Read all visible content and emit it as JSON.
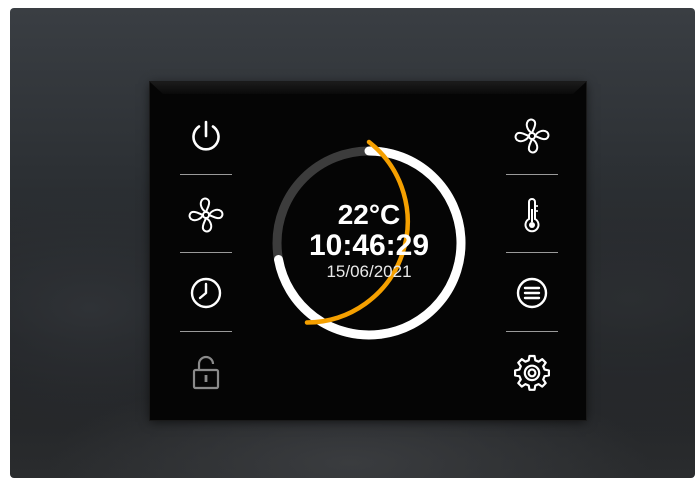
{
  "thermostat": {
    "temperature": "22°C",
    "time": "10:46:29",
    "date": "15/06/2021",
    "setpoint_fraction": 0.5
  },
  "left_buttons": [
    {
      "icon": "power-icon"
    },
    {
      "icon": "fan-icon"
    },
    {
      "icon": "clock-icon"
    },
    {
      "icon": "lock-icon"
    }
  ],
  "right_buttons": [
    {
      "icon": "fan-icon"
    },
    {
      "icon": "thermometer-icon"
    },
    {
      "icon": "menu-icon"
    },
    {
      "icon": "gear-icon"
    }
  ],
  "colors": {
    "accent": "#f5a000",
    "ring": "#ffffff",
    "ring_track": "#3c3c3c",
    "device": "#050505",
    "disabled_icon": "#8a8a8a"
  }
}
